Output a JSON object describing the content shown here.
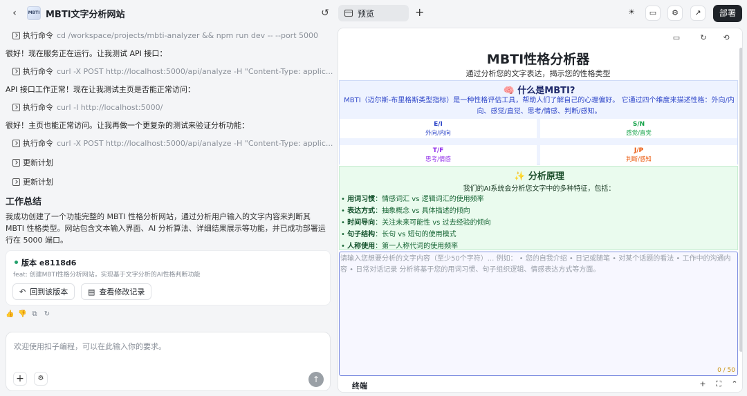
{
  "window": {
    "title": "MBTI文字分析网站",
    "logo_text": "MBTI"
  },
  "log": {
    "rows": [
      {
        "kind": "cmd",
        "label": "执行命令",
        "text": "cd /workspace/projects/mbti-analyzer && npm run dev -- --port 5000"
      },
      {
        "kind": "plain",
        "text": "很好！现在服务正在运行。让我测试 API 接口："
      },
      {
        "kind": "cmd",
        "label": "执行命令",
        "text": "curl -X POST http://localhost:5000/api/analyze -H \"Content-Type: applic..."
      },
      {
        "kind": "plain",
        "text": "API 接口工作正常！现在让我测试主页是否能正常访问："
      },
      {
        "kind": "cmd",
        "label": "执行命令",
        "text": "curl -I http://localhost:5000/"
      },
      {
        "kind": "plain",
        "text": "很好！主页也能正常访问。让我再做一个更复杂的测试来验证分析功能："
      },
      {
        "kind": "cmd",
        "label": "执行命令",
        "text": "curl -X POST http://localhost:5000/api/analyze -H \"Content-Type: applic..."
      },
      {
        "kind": "cmd",
        "label": "更新计划",
        "text": ""
      },
      {
        "kind": "cmd",
        "label": "更新计划",
        "text": ""
      }
    ]
  },
  "summary": {
    "title": "工作总结",
    "text": "我成功创建了一个功能完整的 MBTI 性格分析网站，通过分析用户输入的文字内容来判断其 MBTI 性格类型。网站包含文本输入界面、AI 分析算法、详细结果展示等功能，并已成功部署运行在 5000 端口。"
  },
  "version": {
    "title": "版本 e8118d6",
    "desc": "feat: 创建MBTI性格分析网站，实现基于文字分析的AI性格判断功能",
    "rollback_label": "回到该版本",
    "changes_label": "查看修改记录"
  },
  "chat_input": {
    "placeholder": "欢迎使用扣子编程，可以在此输入你的要求。"
  },
  "right_toolbar": {
    "tab_label": "预览",
    "deploy_label": "部署"
  },
  "site": {
    "title": "MBTI性格分析器",
    "subtitle": "通过分析您的文字表达，揭示您的性格类型",
    "what": {
      "heading": "🧠 什么是MBTI?",
      "desc": "MBTI（迈尔斯-布里格斯类型指标）是一种性格评估工具，帮助人们了解自己的心理偏好。 它通过四个维度来描述性格：外向/内向、感觉/直觉、思考/情感、判断/感知。",
      "dims": [
        {
          "code": "E/I",
          "desc": "外向/内向",
          "color": "#2f47c9"
        },
        {
          "code": "S/N",
          "desc": "感觉/直觉",
          "color": "#16a34a"
        },
        {
          "code": "T/F",
          "desc": "思考/情感",
          "color": "#9333ea"
        },
        {
          "code": "J/P",
          "desc": "判断/感知",
          "color": "#ea580c"
        }
      ]
    },
    "how": {
      "heading": "✨ 分析原理",
      "intro": "我们的AI系统会分析您文字中的多种特征，包括：",
      "items": [
        {
          "name": "用词习惯",
          "desc": "情感词汇 vs 逻辑词汇的使用频率"
        },
        {
          "name": "表达方式",
          "desc": "抽象概念 vs 具体描述的倾向"
        },
        {
          "name": "时间导向",
          "desc": "关注未来可能性 vs 过去经验的倾向"
        },
        {
          "name": "句子结构",
          "desc": "长句 vs 短句的使用模式"
        },
        {
          "name": "人称使用",
          "desc": "第一人称代词的使用频率"
        }
      ]
    },
    "textarea": {
      "placeholder": "请输入您想要分析的文字内容（至少50个字符）... 例如： • 您的自我介绍 • 日记或随笔 • 对某个话题的看法 • 工作中的沟通内容 • 日常对话记录  分析将基于您的用词习惯、句子组织逻辑、情感表达方式等方面。",
      "counter": "0 / 50"
    }
  },
  "terminal": {
    "label": "终端"
  }
}
